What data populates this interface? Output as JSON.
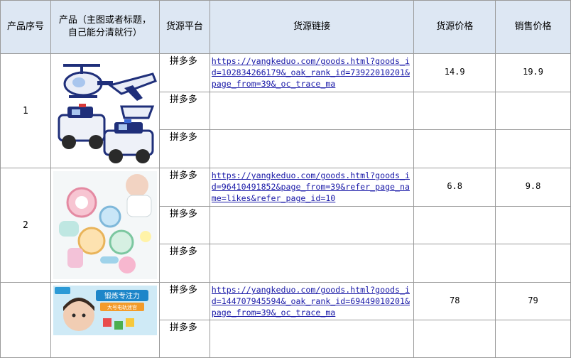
{
  "headers": {
    "seq": "产品序号",
    "product": "产品（主图或者标题，自己能分清就行）",
    "platform": "货源平台",
    "link": "货源链接",
    "source_price": "货源价格",
    "sale_price": "销售价格"
  },
  "products": [
    {
      "seq": "1",
      "image": "police-toy-vehicles-image",
      "platforms": [
        "拼多多",
        "拼多多",
        "拼多多"
      ],
      "link": "https://yangkeduo.com/goods.html?goods_id=102834266179&_oak_rank_id=73922010201&page_from=39&_oc_trace_ma",
      "source_price": "14.9",
      "sale_price": "19.9"
    },
    {
      "seq": "2",
      "image": "baby-rattle-toys-image",
      "platforms": [
        "拼多多",
        "拼多多",
        "拼多多"
      ],
      "link": "https://yangkeduo.com/goods.html?goods_id=96410491852&page_from=39&refer_page_name=likes&refer_page_id=10",
      "source_price": "6.8",
      "sale_price": "9.8"
    },
    {
      "seq": "",
      "image": "child-maze-toy-image",
      "banner_text": "锻炼专注力",
      "banner_sub": "大号电轨迷宫",
      "platforms": [
        "拼多多",
        "拼多多"
      ],
      "link": "https://yangkeduo.com/goods.html?goods_id=144707945594&_oak_rank_id=69449010201&page_from=39&_oc_trace_ma",
      "source_price": "78",
      "sale_price": "79"
    }
  ]
}
